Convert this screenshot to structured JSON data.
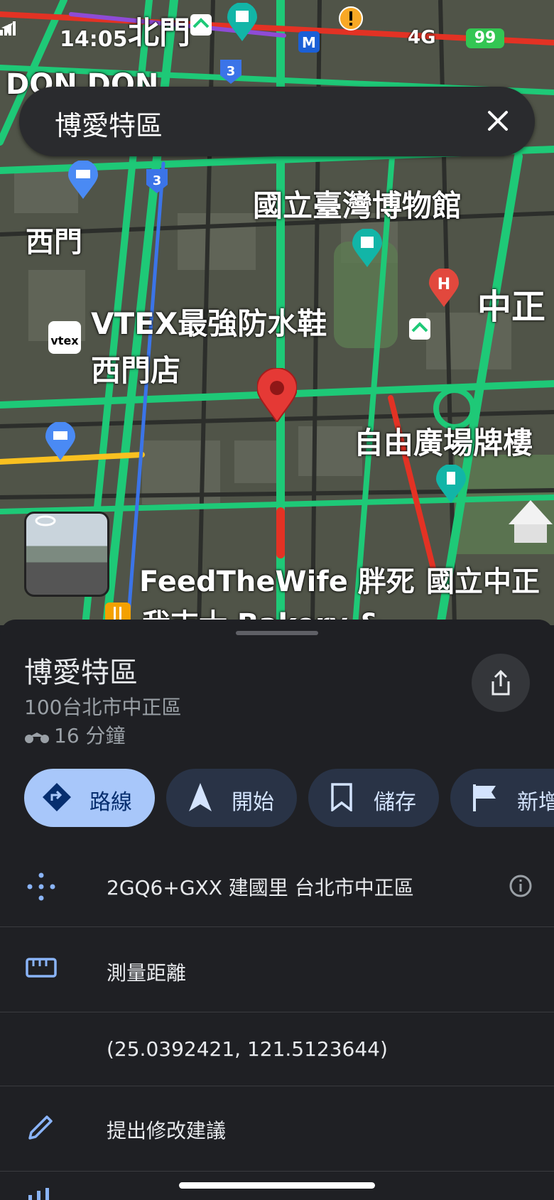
{
  "status_bar": {
    "time": "14:05",
    "network": "4G",
    "battery": "99"
  },
  "search": {
    "query": "博愛特區"
  },
  "map_labels": {
    "beimen": "北門",
    "don_don": "DON DON",
    "ximen": "西門",
    "museum": "國立臺灣博物館",
    "zhongzheng": "中正",
    "vtex_line1": "VTEX最強防水鞋",
    "vtex_line2": "西門店",
    "vtex_logo": "vtex",
    "liberty_square": "自由廣場牌樓",
    "feedthewife": "FeedTheWife 胖死",
    "national_zheng": "國立中正",
    "bakery": "我吉士 Bakery &",
    "route_3": "3",
    "metro": "M"
  },
  "place": {
    "name": "博愛特區",
    "address": "100台北市中正區",
    "travel_time": "16 分鐘"
  },
  "actions": [
    {
      "label": "路線"
    },
    {
      "label": "開始"
    },
    {
      "label": "儲存"
    },
    {
      "label": "新增"
    }
  ],
  "details": {
    "plus_code": "2GQ6+GXX 建國里 台北市中正區",
    "measure": "測量距離",
    "coordinates": "(25.0392421, 121.5123644)",
    "suggest_edit": "提出修改建議"
  },
  "colors": {
    "accent": "#a8c7fa",
    "pin": "#e53935",
    "traffic_green": "#1ec977",
    "traffic_yellow": "#f9c020",
    "traffic_red": "#e33224"
  }
}
